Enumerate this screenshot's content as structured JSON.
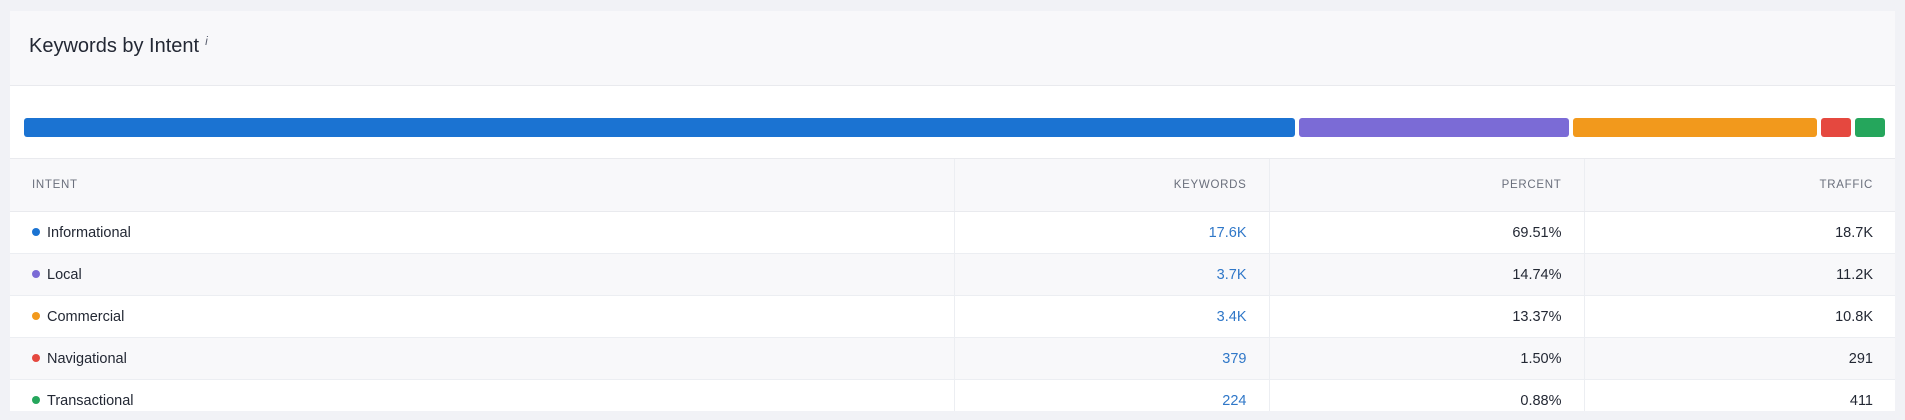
{
  "card": {
    "title": "Keywords by Intent",
    "info_symbol": "i"
  },
  "table": {
    "headers": {
      "intent": "Intent",
      "keywords": "Keywords",
      "percent": "Percent",
      "traffic": "Traffic"
    }
  },
  "intents": [
    {
      "label": "Informational",
      "keywords": "17.6K",
      "percent": "69.51%",
      "traffic": "18.7K",
      "share": 69.51,
      "color": "#1b73d2"
    },
    {
      "label": "Local",
      "keywords": "3.7K",
      "percent": "14.74%",
      "traffic": "11.2K",
      "share": 14.74,
      "color": "#7b6bd6"
    },
    {
      "label": "Commercial",
      "keywords": "3.4K",
      "percent": "13.37%",
      "traffic": "10.8K",
      "share": 13.37,
      "color": "#f2991c"
    },
    {
      "label": "Navigational",
      "keywords": "379",
      "percent": "1.50%",
      "traffic": "291",
      "share": 1.5,
      "color": "#e5483f"
    },
    {
      "label": "Transactional",
      "keywords": "224",
      "percent": "0.88%",
      "traffic": "411",
      "share": 0.88,
      "color": "#25a65c"
    }
  ]
}
